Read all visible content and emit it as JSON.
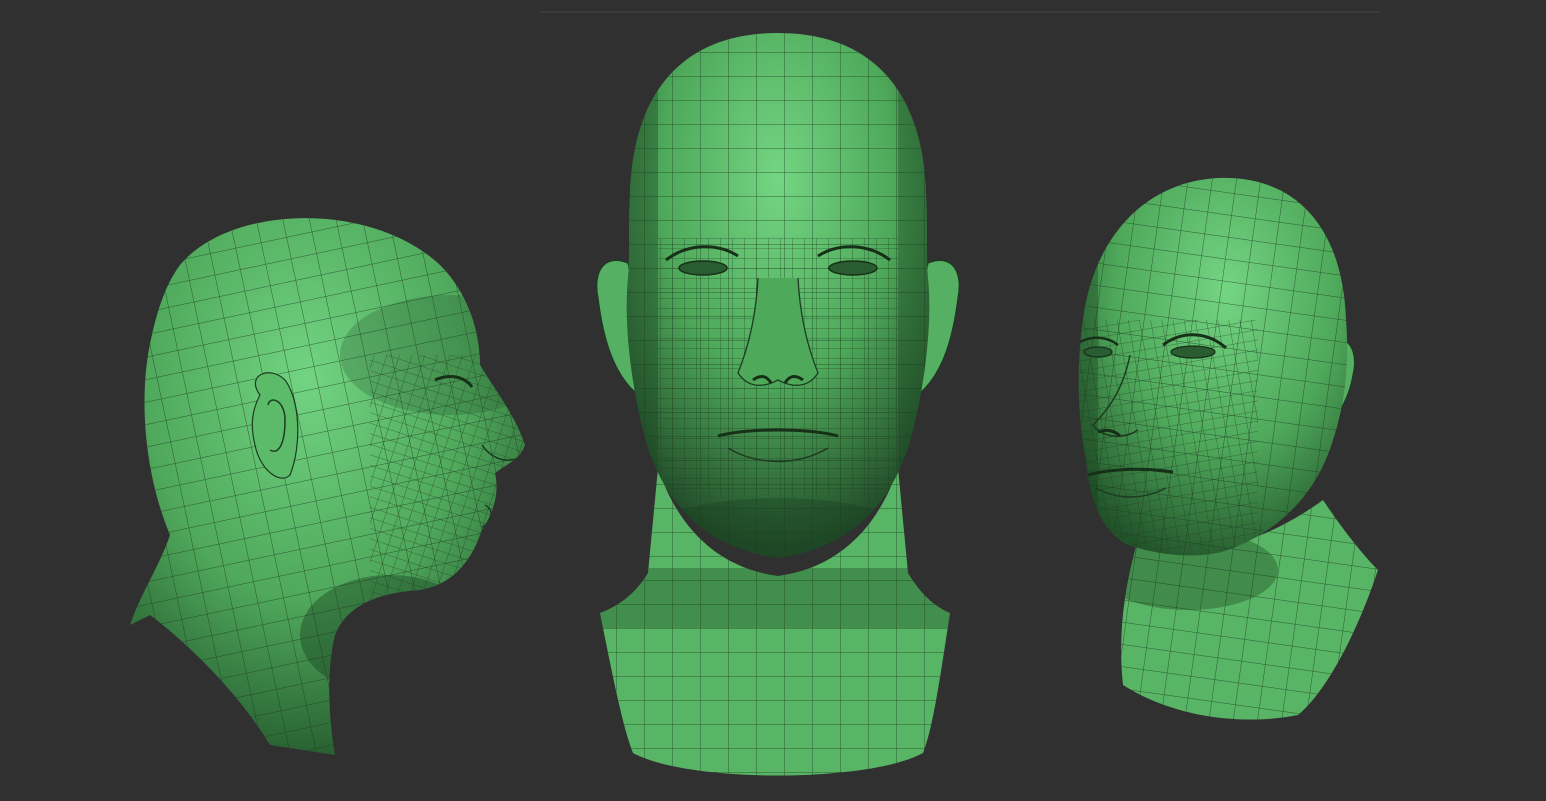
{
  "scene": {
    "background_color": "#303030",
    "model_color": "#4fae5c",
    "highlight_color": "#6fd27e",
    "shadow_color": "#1f4f27",
    "wire_color": "#1d3b21",
    "views": [
      {
        "view": "side-profile",
        "facing": "right"
      },
      {
        "view": "front"
      },
      {
        "view": "three-quarter",
        "facing": "left"
      }
    ]
  }
}
